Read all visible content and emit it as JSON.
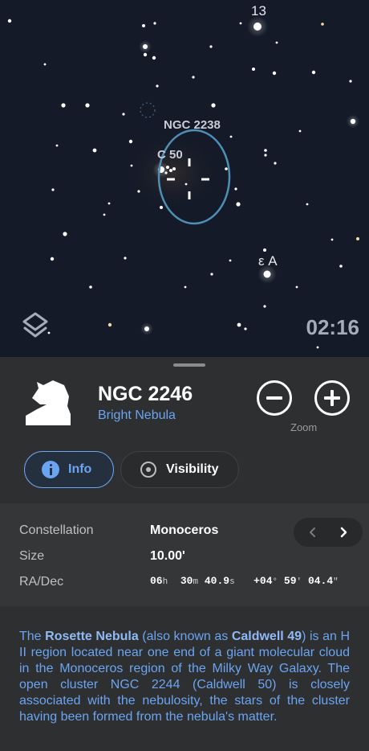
{
  "sky": {
    "label_13": "13",
    "label_ngc2238": "NGC 2238",
    "label_c50": "C 50",
    "label_epsilon": "ε A",
    "time": "02:16"
  },
  "object": {
    "name": "NGC 2246",
    "type": "Bright Nebula",
    "zoom_label": "Zoom"
  },
  "tabs": {
    "info": "Info",
    "visibility": "Visibility"
  },
  "details": {
    "constellation_label": "Constellation",
    "constellation_value": "Monoceros",
    "size_label": "Size",
    "size_value": "10.00'",
    "radec_label": "RA/Dec",
    "ra_h": "06",
    "ra_h_unit": "h",
    "ra_m": "30",
    "ra_m_unit": "m",
    "ra_s": "40.9",
    "ra_s_unit": "s",
    "dec_d": "+04",
    "dec_d_unit": "°",
    "dec_m": "59",
    "dec_m_unit": "'",
    "dec_s": "04.4",
    "dec_s_unit": "\""
  },
  "description": {
    "p1": "The ",
    "b1": "Rosette Nebula",
    "p2": " (also known as ",
    "b2": "Caldwell 49",
    "p3": ") is an H II region located near one end of a giant molecular cloud in the Monoceros region of the Milky Way Galaxy. The open cluster NGC 2244 (Caldwell 50) is closely associated with the nebulosity, the stars of the cluster having been formed from the nebula's matter."
  },
  "colors": {
    "accent": "#6ba4f0",
    "sky_background": "#141a28",
    "selection_ring": "#4d8fb5"
  },
  "icons": {
    "object": "chess-knight-icon",
    "layers": "layers-icon",
    "zoom_out": "minus-circle-icon",
    "zoom_in": "plus-circle-icon",
    "info": "info-icon",
    "visibility": "radio-dot-icon",
    "prev": "chevron-left-icon",
    "next": "chevron-right-icon"
  }
}
